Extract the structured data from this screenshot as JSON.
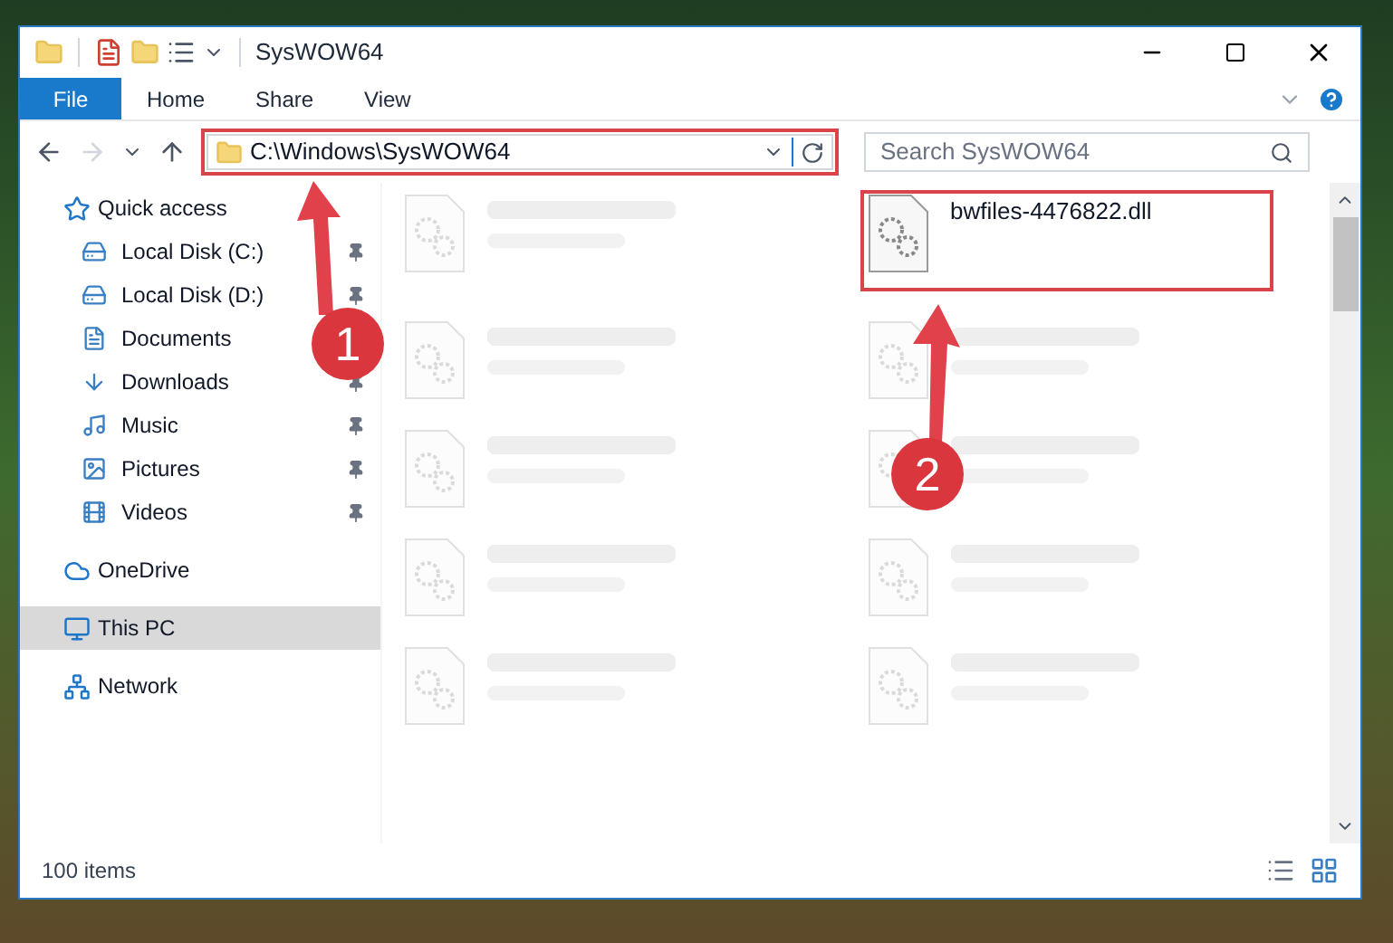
{
  "window": {
    "title": "SysWOW64"
  },
  "ribbon_tabs": [
    {
      "label": "File",
      "kind": "file"
    },
    {
      "label": "Home",
      "kind": "tab"
    },
    {
      "label": "Share",
      "kind": "tab"
    },
    {
      "label": "View",
      "kind": "tab"
    }
  ],
  "address_bar": {
    "path": "C:\\Windows\\SysWOW64"
  },
  "search": {
    "placeholder": "Search SysWOW64"
  },
  "navigation": [
    {
      "label": "Quick access",
      "selected": false,
      "children": [
        {
          "label": "Local Disk (C:)",
          "pinned": true
        },
        {
          "label": "Local Disk (D:)",
          "pinned": true
        },
        {
          "label": "Documents",
          "pinned": false
        },
        {
          "label": "Downloads",
          "pinned": true
        },
        {
          "label": "Music",
          "pinned": true
        },
        {
          "label": "Pictures",
          "pinned": true
        },
        {
          "label": "Videos",
          "pinned": true
        }
      ]
    },
    {
      "label": "OneDrive",
      "selected": false
    },
    {
      "label": "This PC",
      "selected": true
    },
    {
      "label": "Network",
      "selected": false
    }
  ],
  "files": [
    {
      "blurred": true
    },
    {
      "name": "bwfiles-4476822.dll",
      "blurred": false
    },
    {
      "blurred": true
    },
    {
      "blurred": true
    },
    {
      "blurred": true
    },
    {
      "blurred": true
    },
    {
      "blurred": true
    },
    {
      "blurred": true
    },
    {
      "blurred": true
    },
    {
      "blurred": true
    }
  ],
  "status_bar": {
    "item_count": "100 items"
  },
  "annotations": [
    {
      "label": "1"
    },
    {
      "label": "2"
    }
  ]
}
